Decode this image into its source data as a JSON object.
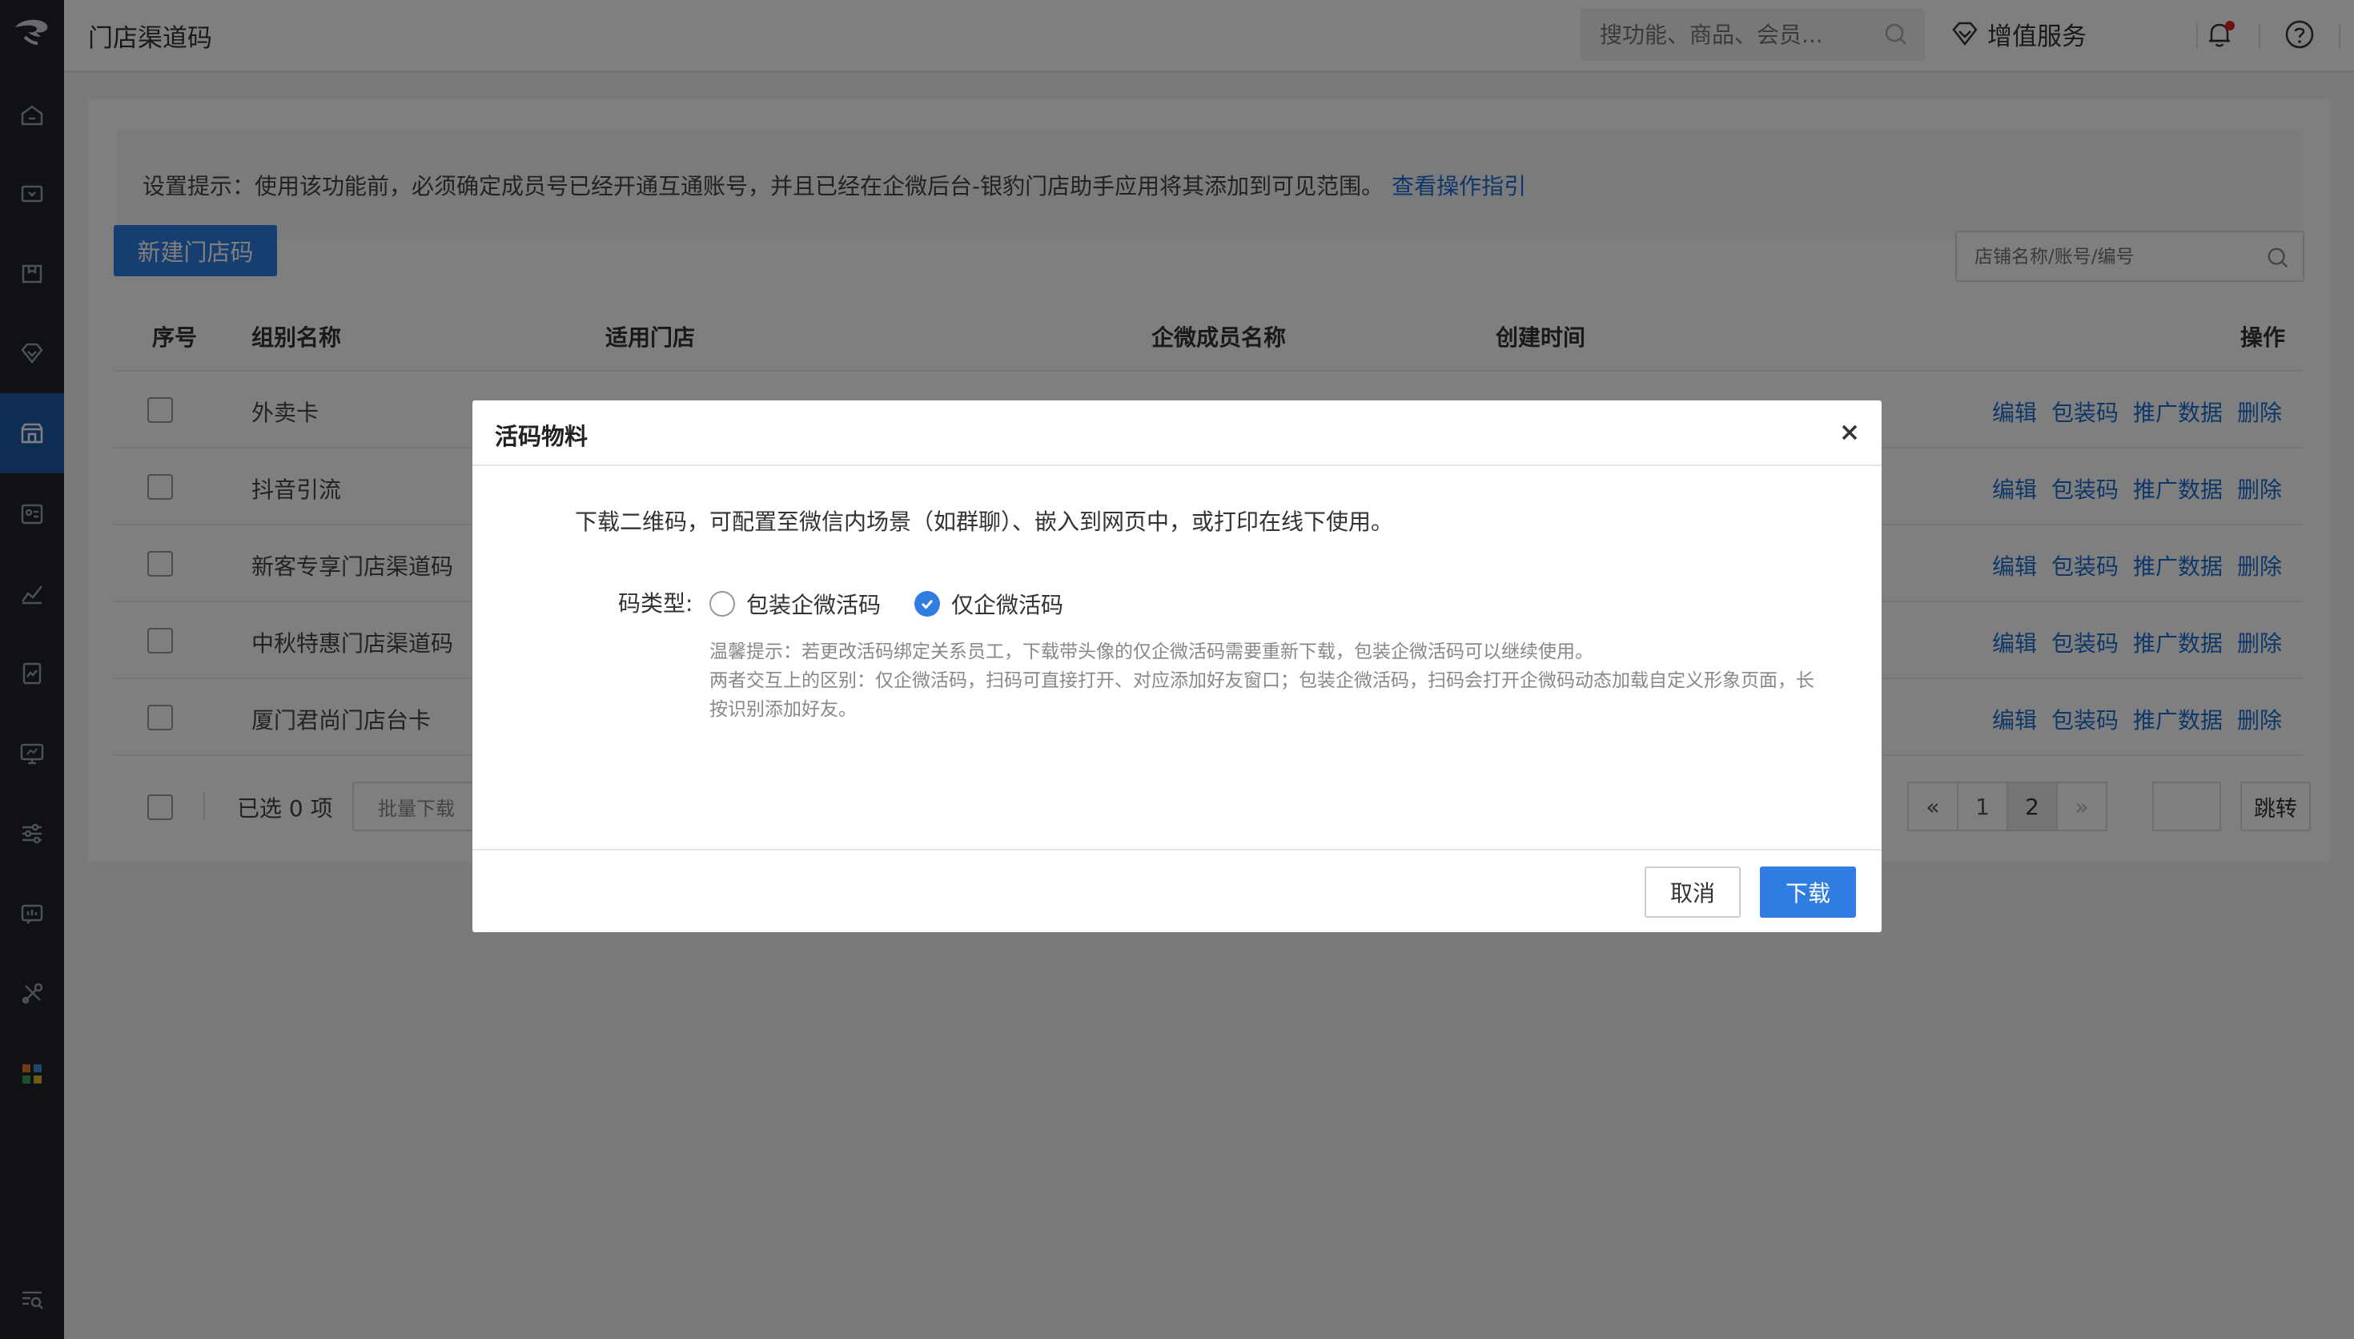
{
  "header": {
    "title": "门店渠道码",
    "search_placeholder": "搜功能、商品、会员...",
    "value_added_label": "增值服务"
  },
  "sidebar": {
    "icons": [
      "home-icon",
      "wallet-icon",
      "box-icon",
      "diamond-icon",
      "store-icon",
      "member-card-icon",
      "chart-icon",
      "report-icon",
      "monitor-icon",
      "sliders-icon",
      "message-icon",
      "tools-icon",
      "apps-icon",
      "search-list-icon"
    ],
    "active_index": 4
  },
  "tip": {
    "text": "设置提示：使用该功能前，必须确定成员号已经开通互通账号，并且已经在企微后台-银豹门店助手应用将其添加到可见范围。",
    "link": "查看操作指引"
  },
  "toolbar": {
    "new_button": "新建门店码",
    "store_search_placeholder": "店铺名称/账号/编号"
  },
  "table": {
    "headers": {
      "index": "序号",
      "group": "组别名称",
      "store": "适用门店",
      "member": "企微成员名称",
      "created": "创建时间",
      "ops": "操作"
    },
    "rows": [
      {
        "group": "外卖卡"
      },
      {
        "group": "抖音引流"
      },
      {
        "group": "新客专享门店渠道码"
      },
      {
        "group": "中秋特惠门店渠道码"
      },
      {
        "group": "厦门君尚门店台卡"
      }
    ],
    "ops": {
      "edit": "编辑",
      "pack_code": "包装码",
      "promo_data": "推广数据",
      "delete": "删除"
    }
  },
  "footer": {
    "selected": "已选 0 项",
    "batch_download": "批量下载",
    "prev": "«",
    "pages": [
      "1",
      "2"
    ],
    "current_page": "2",
    "next": "»",
    "jump": "跳转"
  },
  "modal": {
    "title": "活码物料",
    "description": "下载二维码，可配置至微信内场景（如群聊）、嵌入到网页中，或打印在线下使用。",
    "type_label": "码类型:",
    "options": [
      "包装企微活码",
      "仅企微活码"
    ],
    "selected_option": "仅企微活码",
    "hint1": "温馨提示：若更改活码绑定关系员工，下载带头像的仅企微活码需要重新下载，包装企微活码可以继续使用。",
    "hint2": "两者交互上的区别：仅企微活码，扫码可直接打开、对应添加好友窗口；包装企微活码，扫码会打开企微码动态加载自定义形象页面，长按识别添加好友。",
    "cancel": "取消",
    "confirm": "下载"
  },
  "colors": {
    "primary": "#2f7de1",
    "link": "#1c6fd1",
    "sidebar_bg": "#1f2329",
    "sidebar_active": "#1c5aa6",
    "notification_dot": "#e02020"
  }
}
